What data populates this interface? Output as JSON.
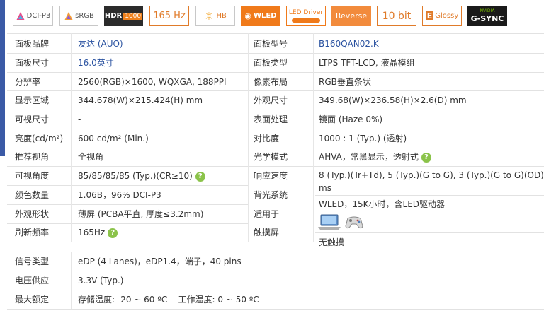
{
  "badges": {
    "dcip3": "DCI-P3",
    "srgb": "sRGB",
    "hdr": "HDR",
    "hdr_num": "1000",
    "hz": "165 Hz",
    "hb": "HB",
    "wled": "WLED",
    "led_driver": "LED Driver",
    "reverse": "Reverse",
    "bit": "10 bit",
    "glossy": "Glossy",
    "nvidia": "NVIDIA",
    "gsync": "G-SYNC"
  },
  "specs": {
    "brand_label": "面板品牌",
    "brand_value": "友达 (AUO)",
    "model_label": "面板型号",
    "model_value": "B160QAN02.K",
    "size_label": "面板尺寸",
    "size_value": "16.0英寸",
    "type_label": "面板类型",
    "type_value": "LTPS TFT-LCD, 液晶模组",
    "res_label": "分辨率",
    "res_value": "2560(RGB)×1600, WQXGA, 188PPI",
    "pixel_label": "像素布局",
    "pixel_value": "RGB垂直条状",
    "area_label": "显示区域",
    "area_value": "344.678(W)×215.424(H) mm",
    "outline_label": "外观尺寸",
    "outline_value": "349.68(W)×236.58(H)×2.6(D) mm",
    "visible_label": "可视尺寸",
    "visible_value": "-",
    "surface_label": "表面处理",
    "surface_value": "镜面 (Haze 0%)",
    "brightness_label": "亮度(cd/m²)",
    "brightness_value": "600 cd/m² (Min.)",
    "contrast_label": "对比度",
    "contrast_value": "1000 : 1 (Typ.) (透射)",
    "recview_label": "推荐视角",
    "recview_value": "全视角",
    "optical_label": "光学模式",
    "optical_value": "AHVA，常黑显示，透射式",
    "viewangle_label": "可视角度",
    "viewangle_value": "85/85/85/85 (Typ.)(CR≥10)",
    "response_label": "响应速度",
    "response_value_1": "8 (Typ.)(Tr+Td), 5 (Typ.)(G to G), 3 (Typ.)(G to G)(OD)",
    "response_value_2": "ms",
    "colors_label": "颜色数量",
    "colors_value": "1.06B，96% DCI-P3",
    "backlight_label": "背光系统",
    "backlight_value": "WLED，15K小时，含LED驱动器",
    "shape_label": "外观形状",
    "shape_value": "薄屏 (PCBA平直, 厚度≤3.2mm)",
    "apply_label": "适用于",
    "refresh_label": "刷新频率",
    "refresh_value": "165Hz",
    "touch_label": "触摸屏",
    "touch_value": "无触摸",
    "signal_label": "信号类型",
    "signal_value": "eDP (4 Lanes)，eDP1.4，端子，40 pins",
    "voltage_label": "电压供应",
    "voltage_value": "3.3V (Typ.)",
    "max_label": "最大额定",
    "max_value": "存储温度: -20 ~ 60 ºC    工作温度: 0 ~ 50 ºC",
    "help_glyph": "?"
  },
  "colors": {
    "link_blue": "#2a52a0",
    "help_green": "#8bc34a",
    "hdr_orange": "#f0821e",
    "wled_orange": "#f07a1a",
    "reverse_orange": "#f28b3c",
    "gsync_black": "#1a1a1a"
  }
}
